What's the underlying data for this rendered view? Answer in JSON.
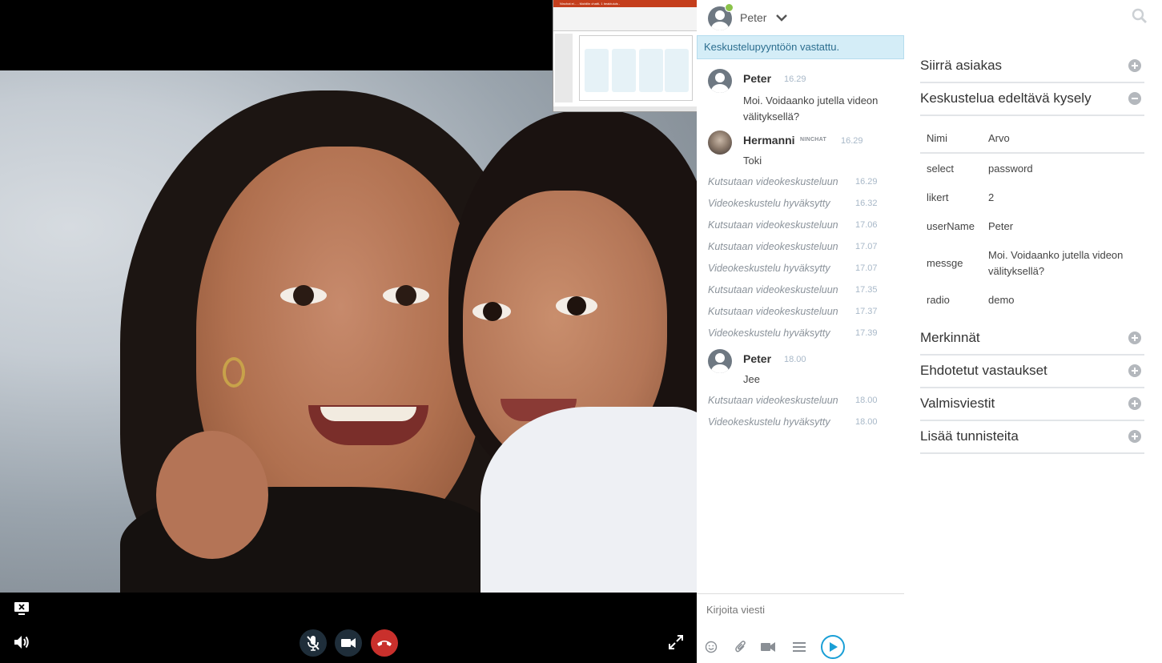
{
  "chat": {
    "header": {
      "name": "Peter"
    },
    "notice": "Keskustelupyyntöön vastattu.",
    "messages": [
      {
        "name": "Peter",
        "time": "16.29",
        "text": "Moi. Voidaanko jutella videon välityksellä?"
      },
      {
        "name": "Hermanni",
        "badge": "NINCHAT",
        "time": "16.29",
        "text": "Toki"
      }
    ],
    "system_events": [
      {
        "text": "Kutsutaan videokeskusteluun",
        "time": "16.29"
      },
      {
        "text": "Videokeskustelu hyväksytty",
        "time": "16.32"
      },
      {
        "text": "Kutsutaan videokeskusteluun",
        "time": "17.06"
      },
      {
        "text": "Kutsutaan videokeskusteluun",
        "time": "17.07"
      },
      {
        "text": "Videokeskustelu hyväksytty",
        "time": "17.07"
      },
      {
        "text": "Kutsutaan videokeskusteluun",
        "time": "17.35"
      },
      {
        "text": "Kutsutaan videokeskusteluun",
        "time": "17.37"
      },
      {
        "text": "Videokeskustelu hyväksytty",
        "time": "17.39"
      }
    ],
    "message3": {
      "name": "Peter",
      "time": "18.00",
      "text": "Jee"
    },
    "system_events2": [
      {
        "text": "Kutsutaan videokeskusteluun",
        "time": "18.00"
      },
      {
        "text": "Videokeskustelu hyväksytty",
        "time": "18.00"
      }
    ],
    "composer": {
      "placeholder": "Kirjoita viesti"
    }
  },
  "side": {
    "sections": [
      {
        "title": "Siirrä asiakas",
        "state": "collapsed"
      },
      {
        "title": "Keskustelua edeltävä kysely",
        "state": "expanded"
      },
      {
        "title": "Merkinnät",
        "state": "collapsed"
      },
      {
        "title": "Ehdotetut vastaukset",
        "state": "collapsed"
      },
      {
        "title": "Valmisviestit",
        "state": "collapsed"
      },
      {
        "title": "Lisää tunnisteita",
        "state": "collapsed"
      }
    ],
    "survey": [
      {
        "key": "Nimi",
        "value": "Arvo"
      },
      {
        "key": "select",
        "value": "password"
      },
      {
        "key": "likert",
        "value": "2"
      },
      {
        "key": "userName",
        "value": "Peter"
      },
      {
        "key": "messge",
        "value": "Moi. Voidaanko jutella videon välityksellä?"
      },
      {
        "key": "radio",
        "value": "demo"
      }
    ]
  },
  "video": {
    "controls": [
      "screen-share-off-icon",
      "volume-icon",
      "mic-muted-icon",
      "camera-icon",
      "hang-up-icon",
      "fullscreen-icon"
    ],
    "screen_share_title": "Ninchat ei... - Mobiilin chatti- 1 beaktuiuls -"
  },
  "colors": {
    "accent": "#1a9fd6",
    "notice_bg": "#d4edf7",
    "hangup": "#c9302c",
    "online": "#8bc34a"
  }
}
